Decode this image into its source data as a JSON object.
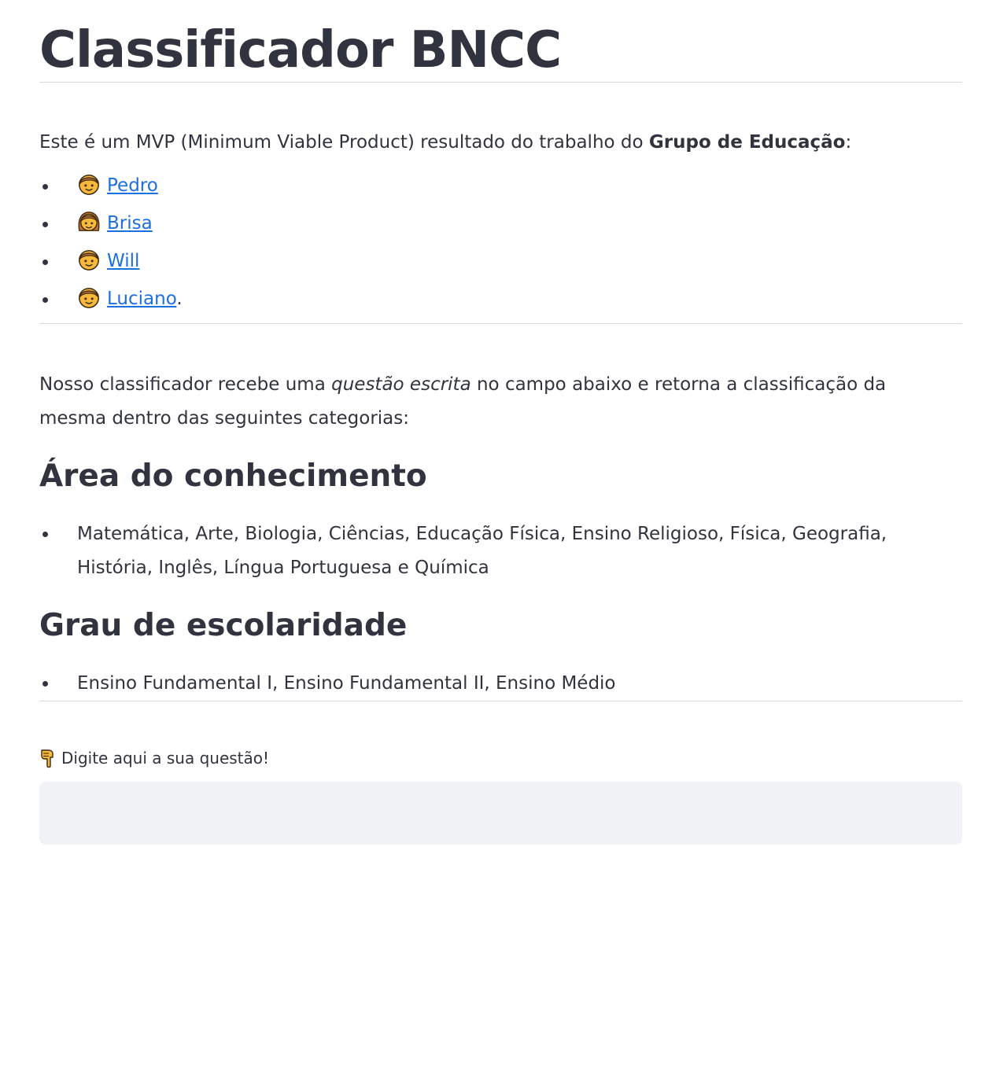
{
  "header": {
    "title": "Classificador BNCC"
  },
  "intro": {
    "text_before": "Este é um MVP (Minimum Viable Product) resultado do trabalho do ",
    "group_name": "Grupo de Educação",
    "text_after": ":"
  },
  "members": [
    {
      "name": "Pedro",
      "emoji": "boy-face-icon",
      "suffix": ""
    },
    {
      "name": "Brisa",
      "emoji": "girl-face-icon",
      "suffix": ""
    },
    {
      "name": "Will",
      "emoji": "boy-face-icon",
      "suffix": ""
    },
    {
      "name": "Luciano",
      "emoji": "boy-face-icon",
      "suffix": "."
    }
  ],
  "description": {
    "text_before": "Nosso classificador recebe uma ",
    "emphasis": "questão escrita",
    "text_after": " no campo abaixo e retorna a classificação da mesma dentro das seguintes categorias:"
  },
  "sections": [
    {
      "heading": "Área do conhecimento",
      "items": [
        "Matemática, Arte, Biologia, Ciências, Educação Física, Ensino Religioso, Física, Geografia, História, Inglês, Língua Portuguesa e Química"
      ]
    },
    {
      "heading": "Grau de escolaridade",
      "items": [
        "Ensino Fundamental I, Ensino Fundamental II, Ensino Médio"
      ]
    }
  ],
  "question": {
    "label": "Digite aqui a sua questão!",
    "label_icon": "pointing-down-hand-icon",
    "value": "",
    "placeholder": ""
  },
  "colors": {
    "text": "#31333f",
    "link": "#1c6fe0",
    "input_bg": "#f0f2f6",
    "divider": "#d9d9dd"
  }
}
